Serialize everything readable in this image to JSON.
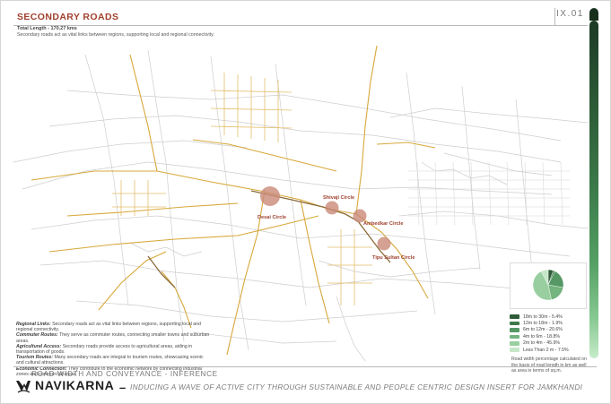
{
  "header": {
    "title": "SECONDARY ROADS",
    "sheet_number": "IX.01",
    "total_length": "Total Length - 170.27 kms",
    "description": "Secondary roads act as vital links between regions, supporting local and regional connectivity."
  },
  "map": {
    "circles": [
      {
        "label": "Desai Circle"
      },
      {
        "label": "Shivaji Circle"
      },
      {
        "label": "Ambedkar Circle"
      },
      {
        "label": "Tipu Sultan Circle"
      }
    ],
    "colors": {
      "secondary_road": "#d7a83a",
      "local_road": "#c7c7c7",
      "circle_marker": "#c98a78",
      "label": "#a0412e"
    }
  },
  "notes": [
    {
      "term": "Regional Links:",
      "text": "Secondary roads act as vital links between regions, supporting local and regional connectivity."
    },
    {
      "term": "Commuter Routes:",
      "text": "They serve as commuter routes, connecting smaller towns and suburban areas."
    },
    {
      "term": "Agricultural Access:",
      "text": "Secondary roads provide access to agricultural areas, aiding in transportation of goods."
    },
    {
      "term": "Tourism Routes:",
      "text": "Many secondary roads are integral to tourism routes, showcasing scenic and cultural attractions."
    },
    {
      "term": "Economic Connection:",
      "text": "They contribute to the economic network by connecting industrial zones and commercial areas."
    }
  ],
  "chart_data": {
    "type": "pie",
    "categories": [
      "18m to 30m",
      "12m to 18m",
      "6m to 12m",
      "4m to 6m",
      "2m to 4m",
      "Less Than 2 m"
    ],
    "values": [
      5.4,
      1.9,
      20.6,
      18.8,
      45.9,
      7.5
    ],
    "colors": [
      "#2f5b39",
      "#3f7a4b",
      "#559865",
      "#74b47f",
      "#99cfa0",
      "#c5e6c7"
    ]
  },
  "legend": {
    "items": [
      {
        "label": "18m to 30m - 5.4%",
        "color": "#2f5b39"
      },
      {
        "label": "12m to 18m - 1.9%",
        "color": "#3f7a4b"
      },
      {
        "label": "6m to 12m - 20.6%",
        "color": "#559865"
      },
      {
        "label": "4m to 6m - 18.8%",
        "color": "#74b47f"
      },
      {
        "label": "2m to 4m - 45.9%",
        "color": "#99cfa0"
      },
      {
        "label": "Less Than 2 m - 7.5%",
        "color": "#c5e6c7"
      }
    ],
    "note": "Road width percentage calculated on the basis of road length in km as well as area in terms of sq.m."
  },
  "footer": {
    "subtitle": "ROAD WIDTH AND CONVEYANCE - INFERENCE",
    "brand": "NAVIKARNA",
    "tagline": "INDUCING A WAVE OF ACTIVE CITY THROUGH SUSTAINABLE AND PEOPLE CENTRIC DESIGN INSERT FOR JAMKHANDI"
  }
}
